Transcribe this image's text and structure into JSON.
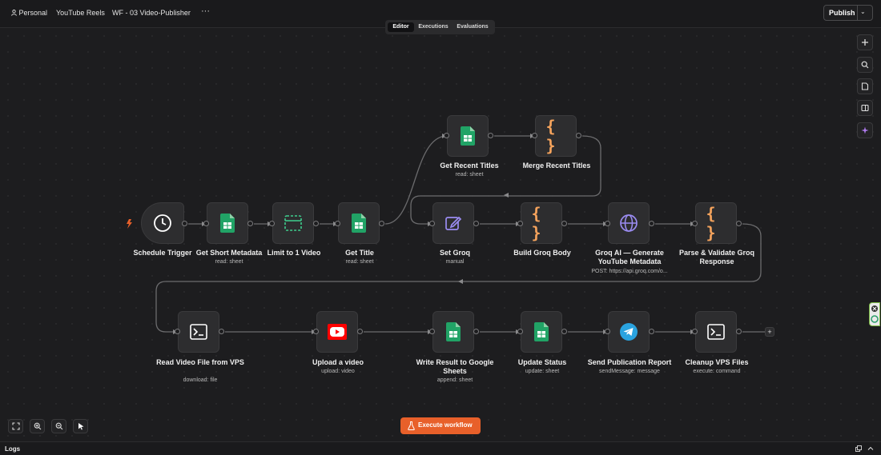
{
  "header": {
    "breadcrumbs": [
      "Personal",
      "YouTube Reels",
      "WF - 03  Video-Publisher"
    ],
    "more_label": "···",
    "publish_label": "Publish"
  },
  "tabs": [
    {
      "label": "Editor",
      "active": true
    },
    {
      "label": "Executions",
      "active": false
    },
    {
      "label": "Evaluations",
      "active": false
    }
  ],
  "nodes": [
    {
      "id": "schedule",
      "title": "Schedule Trigger",
      "subtitle": "",
      "icon": "clock-icon"
    },
    {
      "id": "get-short",
      "title": "Get Short Metadata",
      "subtitle": "read: sheet",
      "icon": "google-sheets-icon"
    },
    {
      "id": "limit",
      "title": "Limit to 1 Video",
      "subtitle": "",
      "icon": "limit-icon"
    },
    {
      "id": "get-title",
      "title": "Get Title",
      "subtitle": "read: sheet",
      "icon": "google-sheets-icon"
    },
    {
      "id": "get-recent",
      "title": "Get Recent Titles",
      "subtitle": "read: sheet",
      "icon": "google-sheets-icon"
    },
    {
      "id": "merge-recent",
      "title": "Merge Recent Titles",
      "subtitle": "",
      "icon": "code-braces-icon"
    },
    {
      "id": "set-groq",
      "title": "Set Groq",
      "subtitle": "manual",
      "icon": "edit-pen-icon"
    },
    {
      "id": "build-groq",
      "title": "Build Groq Body",
      "subtitle": "",
      "icon": "code-braces-icon"
    },
    {
      "id": "groq-ai",
      "title": "Groq AI — Generate YouTube Metadata",
      "subtitle": "POST: https://api.groq.com/o...",
      "icon": "globe-icon"
    },
    {
      "id": "parse-groq",
      "title": "Parse & Validate Groq Response",
      "subtitle": "",
      "icon": "code-braces-icon"
    },
    {
      "id": "read-video",
      "title": "Read Video File from VPS",
      "subtitle": "download: file",
      "icon": "terminal-icon"
    },
    {
      "id": "upload-video",
      "title": "Upload a video",
      "subtitle": "upload: video",
      "icon": "youtube-icon"
    },
    {
      "id": "write-result",
      "title": "Write Result to Google Sheets",
      "subtitle": "append: sheet",
      "icon": "google-sheets-icon"
    },
    {
      "id": "update-status",
      "title": "Update Status",
      "subtitle": "update: sheet",
      "icon": "google-sheets-icon"
    },
    {
      "id": "send-report",
      "title": "Send Publication Report",
      "subtitle": "sendMessage: message",
      "icon": "telegram-icon"
    },
    {
      "id": "cleanup",
      "title": "Cleanup VPS Files",
      "subtitle": "execute: command",
      "icon": "terminal-icon"
    }
  ],
  "toolbar": {
    "execute_label": "Execute workflow"
  },
  "logs": {
    "label": "Logs"
  },
  "colors": {
    "accent": "#e8602a",
    "sheets_green": "#21a366",
    "code_orange": "#f5a35c",
    "purple_icon": "#9b8cf2",
    "youtube_red": "#ff0000",
    "telegram_blue": "#2aa3df"
  }
}
